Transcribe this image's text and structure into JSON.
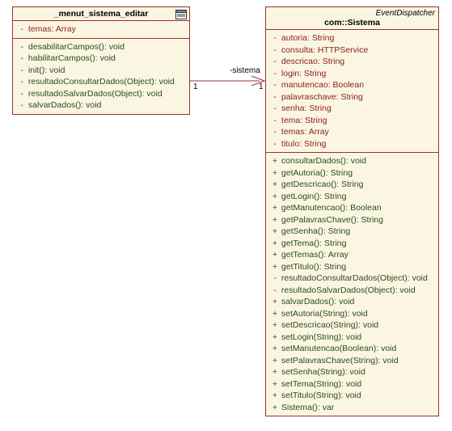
{
  "left": {
    "title": "_menut_sistema_editar",
    "attrs": [
      {
        "vis": "-",
        "name": "temas",
        "type": "Array"
      }
    ],
    "ops": [
      {
        "vis": "-",
        "name": "desabilitarCampos()",
        "type": "void"
      },
      {
        "vis": "-",
        "name": "habilitarCampos()",
        "type": "void"
      },
      {
        "vis": "-",
        "name": "init()",
        "type": "void"
      },
      {
        "vis": "-",
        "name": "resultadoConsultarDados(Object)",
        "type": "void"
      },
      {
        "vis": "-",
        "name": "resultadoSalvarDados(Object)",
        "type": "void"
      },
      {
        "vis": "-",
        "name": "salvarDados()",
        "type": "void"
      }
    ]
  },
  "right": {
    "stereo": "EventDispatcher",
    "title": "com::Sistema",
    "attrs": [
      {
        "vis": "-",
        "name": "autoria",
        "type": "String"
      },
      {
        "vis": "-",
        "name": "consulta",
        "type": "HTTPService"
      },
      {
        "vis": "-",
        "name": "descricao",
        "type": "String"
      },
      {
        "vis": "-",
        "name": "login",
        "type": "String"
      },
      {
        "vis": "-",
        "name": "manutencao",
        "type": "Boolean"
      },
      {
        "vis": "-",
        "name": "palavraschave",
        "type": "String"
      },
      {
        "vis": "-",
        "name": "senha",
        "type": "String"
      },
      {
        "vis": "-",
        "name": "tema",
        "type": "String"
      },
      {
        "vis": "-",
        "name": "temas",
        "type": "Array"
      },
      {
        "vis": "-",
        "name": "titulo",
        "type": "String"
      }
    ],
    "ops": [
      {
        "vis": "+",
        "name": "consultarDados()",
        "type": "void"
      },
      {
        "vis": "+",
        "name": "getAutoria()",
        "type": "String"
      },
      {
        "vis": "+",
        "name": "getDescricao()",
        "type": "String"
      },
      {
        "vis": "+",
        "name": "getLogin()",
        "type": "String"
      },
      {
        "vis": "+",
        "name": "getManutencao()",
        "type": "Boolean"
      },
      {
        "vis": "+",
        "name": "getPalavrasChave()",
        "type": "String"
      },
      {
        "vis": "+",
        "name": "getSenha()",
        "type": "String"
      },
      {
        "vis": "+",
        "name": "getTema()",
        "type": "String"
      },
      {
        "vis": "+",
        "name": "getTemas()",
        "type": "Array"
      },
      {
        "vis": "+",
        "name": "getTitulo()",
        "type": "String"
      },
      {
        "vis": "-",
        "name": "resultadoConsultarDados(Object)",
        "type": "void"
      },
      {
        "vis": "-",
        "name": "resultadoSalvarDados(Object)",
        "type": "void"
      },
      {
        "vis": "+",
        "name": "salvarDados()",
        "type": "void"
      },
      {
        "vis": "+",
        "name": "setAutoria(String)",
        "type": "void"
      },
      {
        "vis": "+",
        "name": "setDescricao(String)",
        "type": "void"
      },
      {
        "vis": "+",
        "name": "setLogin(String)",
        "type": "void"
      },
      {
        "vis": "+",
        "name": "setManutencao(Boolean)",
        "type": "void"
      },
      {
        "vis": "+",
        "name": "setPalavrasChave(String)",
        "type": "void"
      },
      {
        "vis": "+",
        "name": "setSenha(String)",
        "type": "void"
      },
      {
        "vis": "+",
        "name": "setTema(String)",
        "type": "void"
      },
      {
        "vis": "+",
        "name": "setTitulo(String)",
        "type": "void"
      },
      {
        "vis": "+",
        "name": "Sistema()",
        "type": "var"
      }
    ]
  },
  "connector": {
    "label": "-sistema",
    "multA": "1",
    "multB": "1"
  }
}
